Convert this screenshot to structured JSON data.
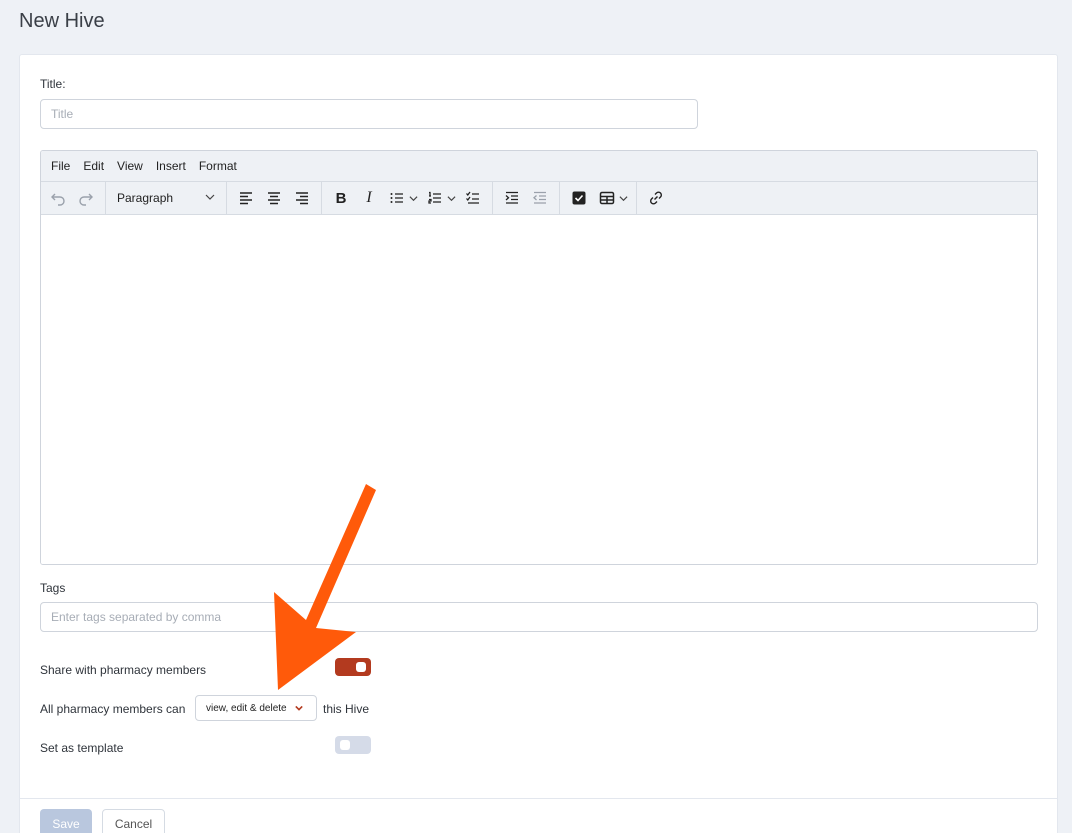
{
  "page": {
    "title": "New Hive"
  },
  "title_field": {
    "label": "Title:",
    "placeholder": "Title",
    "value": ""
  },
  "editor": {
    "menu": [
      "File",
      "Edit",
      "View",
      "Insert",
      "Format"
    ],
    "block_format": "Paragraph",
    "icons": [
      "undo-icon",
      "redo-icon",
      "align-left-icon",
      "align-center-icon",
      "align-right-icon",
      "bold-icon",
      "italic-icon",
      "bullet-list-icon",
      "numbered-list-icon",
      "checklist-icon",
      "indent-icon",
      "outdent-icon",
      "checkbox-icon",
      "table-icon",
      "link-icon"
    ]
  },
  "tags_field": {
    "label": "Tags",
    "placeholder": "Enter tags separated by comma",
    "value": ""
  },
  "share": {
    "label": "Share with pharmacy members",
    "enabled": true,
    "color_on": "#b33a1f"
  },
  "permission": {
    "prefix": "All pharmacy members can",
    "selected": "view, edit & delete",
    "suffix": "this Hive"
  },
  "template": {
    "label": "Set as template",
    "enabled": false,
    "color_off": "#d5dbe8"
  },
  "footer": {
    "save_label": "Save",
    "cancel_label": "Cancel"
  },
  "annotation": {
    "arrow_color": "#ff5a0a"
  }
}
